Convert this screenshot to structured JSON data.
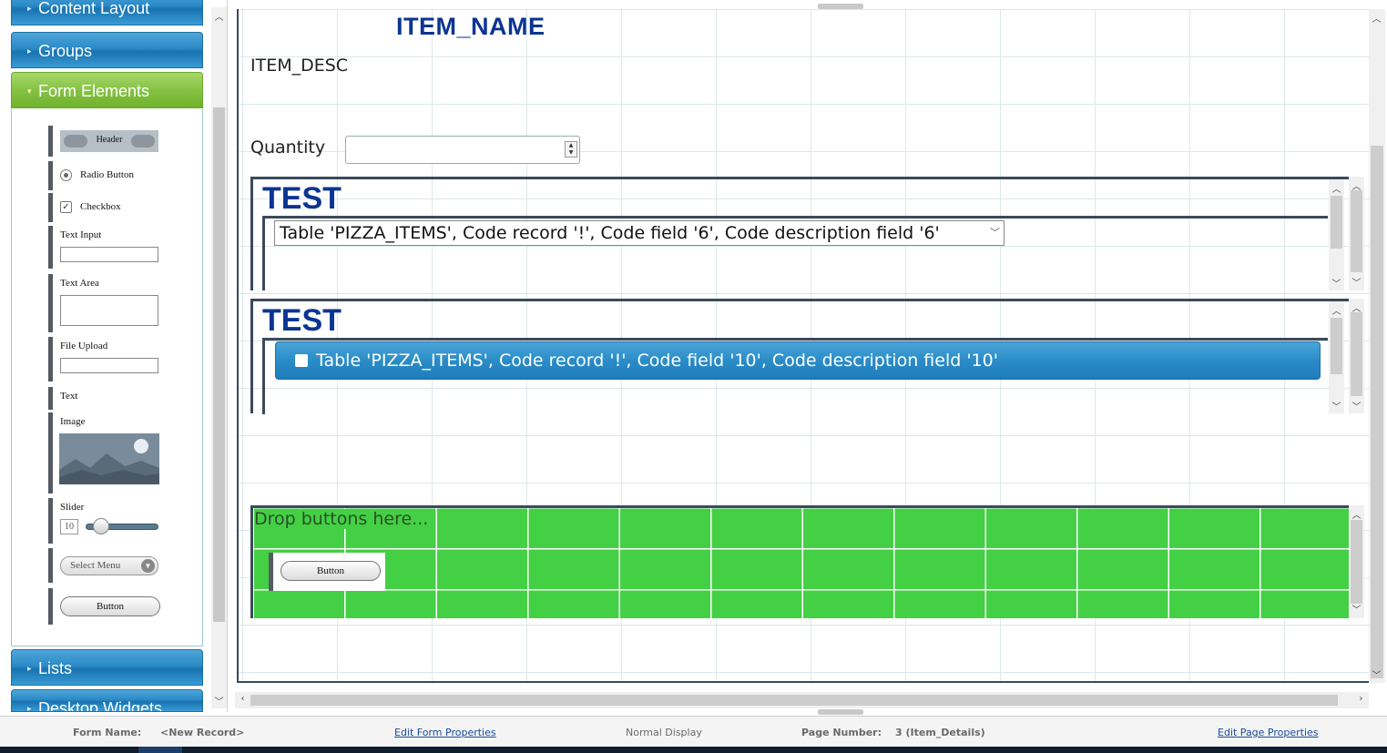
{
  "left_panel": {
    "accordion": [
      {
        "label": "Content Layout",
        "active": false
      },
      {
        "label": "Groups",
        "active": false
      },
      {
        "label": "Form Elements",
        "active": true
      },
      {
        "label": "Lists",
        "active": false
      },
      {
        "label": "Desktop Widgets",
        "active": false
      }
    ],
    "form_elements": {
      "header": "Header",
      "radio": "Radio Button",
      "checkbox": "Checkbox",
      "text_input": "Text Input",
      "text_area": "Text Area",
      "file_upload": "File Upload",
      "text": "Text",
      "image": "Image",
      "slider": "Slider",
      "slider_value": "10",
      "select_menu": "Select Menu",
      "button": "Button"
    }
  },
  "canvas": {
    "item_name": "ITEM_NAME",
    "item_desc": "ITEM_DESC",
    "quantity_label": "Quantity",
    "quantity_value": "",
    "section1": {
      "title": "TEST",
      "select_value": "Table 'PIZZA_ITEMS', Code record '!', Code field '6', Code description field '6'"
    },
    "section2": {
      "title": "TEST",
      "checkbox_label": "Table 'PIZZA_ITEMS', Code record '!', Code field '10', Code description field '10'"
    },
    "drop_zone": {
      "label": "Drop buttons here...",
      "button_label": "Button"
    }
  },
  "status_bar": {
    "form_name_label": "Form Name:",
    "form_name_value": "<New Record>",
    "edit_form_link": "Edit Form Properties",
    "display_mode": "Normal Display",
    "page_number_label": "Page Number:",
    "page_number_value": "3 (Item_Details)",
    "edit_page_link": "Edit Page Properties"
  },
  "colors": {
    "accent_blue": "#2b8ac7",
    "active_green": "#86c244",
    "drop_zone_green": "#44d044",
    "title_navy": "#0b3591"
  }
}
